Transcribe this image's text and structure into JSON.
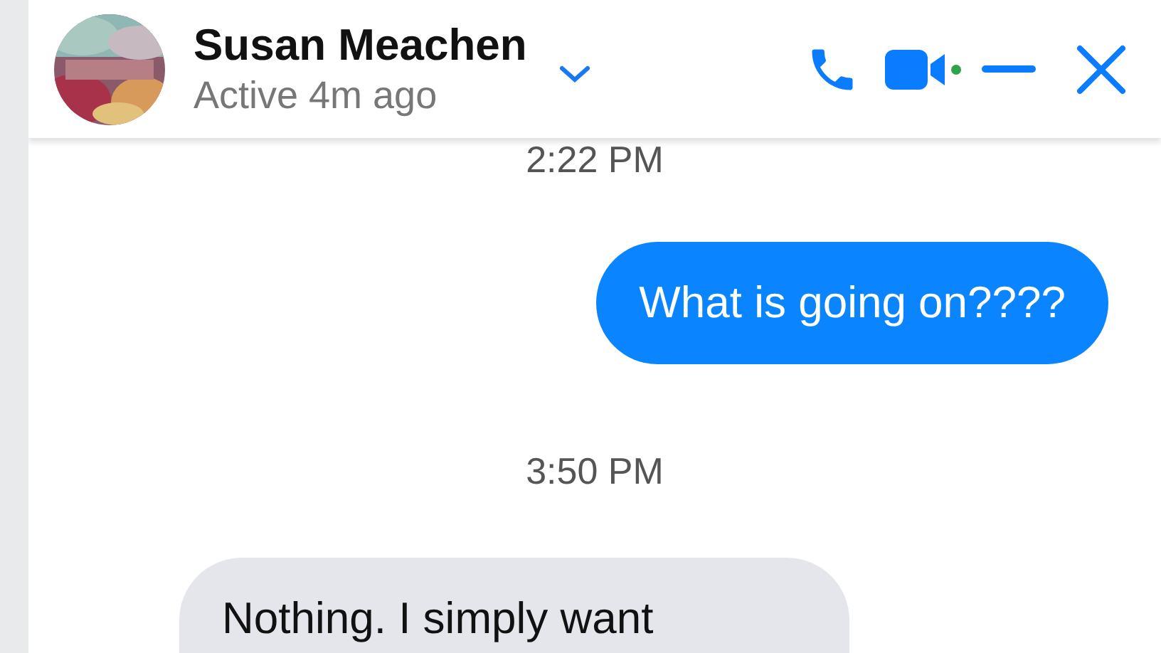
{
  "header": {
    "name": "Susan Meachen",
    "status": "Active 4m ago"
  },
  "messages": [
    {
      "kind": "timestamp",
      "text": "2:22 PM"
    },
    {
      "kind": "outgoing",
      "text": "What is going on????"
    },
    {
      "kind": "timestamp",
      "text": "3:50 PM"
    },
    {
      "kind": "incoming",
      "text": "Nothing. I simply want"
    }
  ]
}
